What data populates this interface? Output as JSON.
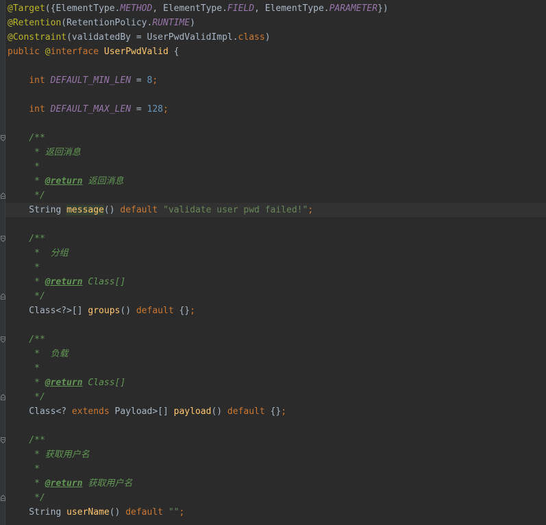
{
  "editor": {
    "theme_colors": {
      "background": "#2b2b2b",
      "annotation": "#bbb529",
      "keyword": "#cc7832",
      "constant": "#9876aa",
      "number": "#6897bb",
      "string": "#6a8759",
      "method": "#ffc66d",
      "doc_comment": "#629755",
      "text": "#a9b7c6"
    },
    "lines": [
      {
        "tokens": [
          {
            "c": "ann",
            "t": "@Target"
          },
          {
            "c": "plain",
            "t": "({ElementType."
          },
          {
            "c": "const",
            "t": "METHOD"
          },
          {
            "c": "plain",
            "t": ", ElementType."
          },
          {
            "c": "const",
            "t": "FIELD"
          },
          {
            "c": "plain",
            "t": ", ElementType."
          },
          {
            "c": "const",
            "t": "PARAMETER"
          },
          {
            "c": "plain",
            "t": "})"
          }
        ]
      },
      {
        "tokens": [
          {
            "c": "ann",
            "t": "@Retention"
          },
          {
            "c": "plain",
            "t": "(RetentionPolicy."
          },
          {
            "c": "const",
            "t": "RUNTIME"
          },
          {
            "c": "plain",
            "t": ")"
          }
        ]
      },
      {
        "tokens": [
          {
            "c": "ann",
            "t": "@Constraint"
          },
          {
            "c": "plain",
            "t": "(validatedBy = UserPwdValidImpl."
          },
          {
            "c": "kw",
            "t": "class"
          },
          {
            "c": "plain",
            "t": ")"
          }
        ]
      },
      {
        "tokens": [
          {
            "c": "kw",
            "t": "public "
          },
          {
            "c": "ann",
            "t": "@"
          },
          {
            "c": "kw",
            "t": "interface "
          },
          {
            "c": "fn",
            "t": "UserPwdValid"
          },
          {
            "c": "plain",
            "t": " {"
          }
        ]
      },
      {
        "tokens": []
      },
      {
        "tokens": [
          {
            "c": "plain",
            "t": "    "
          },
          {
            "c": "kw",
            "t": "int "
          },
          {
            "c": "const",
            "t": "DEFAULT_MIN_LEN"
          },
          {
            "c": "plain",
            "t": " = "
          },
          {
            "c": "num",
            "t": "8"
          },
          {
            "c": "kw",
            "t": ";"
          }
        ]
      },
      {
        "tokens": []
      },
      {
        "tokens": [
          {
            "c": "plain",
            "t": "    "
          },
          {
            "c": "kw",
            "t": "int "
          },
          {
            "c": "const",
            "t": "DEFAULT_MAX_LEN"
          },
          {
            "c": "plain",
            "t": " = "
          },
          {
            "c": "num",
            "t": "128"
          },
          {
            "c": "kw",
            "t": ";"
          }
        ]
      },
      {
        "tokens": []
      },
      {
        "tokens": [
          {
            "c": "doc",
            "t": "    /**"
          }
        ]
      },
      {
        "tokens": [
          {
            "c": "doc",
            "t": "     * 返回消息"
          }
        ]
      },
      {
        "tokens": [
          {
            "c": "doc",
            "t": "     *"
          }
        ]
      },
      {
        "tokens": [
          {
            "c": "doc",
            "t": "     * "
          },
          {
            "c": "tag",
            "t": "@return"
          },
          {
            "c": "doc",
            "t": " 返回消息"
          }
        ]
      },
      {
        "tokens": [
          {
            "c": "doc",
            "t": "     */"
          }
        ]
      },
      {
        "tokens": [
          {
            "c": "plain",
            "t": "    String "
          },
          {
            "c": "fn hl",
            "t": "message"
          },
          {
            "c": "plain",
            "t": "() "
          },
          {
            "c": "kw",
            "t": "default "
          },
          {
            "c": "str",
            "t": "\"validate user pwd failed!\""
          },
          {
            "c": "kw",
            "t": ";"
          }
        ]
      },
      {
        "tokens": []
      },
      {
        "tokens": [
          {
            "c": "doc",
            "t": "    /**"
          }
        ]
      },
      {
        "tokens": [
          {
            "c": "doc",
            "t": "     *  分组"
          }
        ]
      },
      {
        "tokens": [
          {
            "c": "doc",
            "t": "     *"
          }
        ]
      },
      {
        "tokens": [
          {
            "c": "doc",
            "t": "     * "
          },
          {
            "c": "tag",
            "t": "@return"
          },
          {
            "c": "doc",
            "t": " Class[]"
          }
        ]
      },
      {
        "tokens": [
          {
            "c": "doc",
            "t": "     */"
          }
        ]
      },
      {
        "tokens": [
          {
            "c": "plain",
            "t": "    Class<?>[] "
          },
          {
            "c": "fn",
            "t": "groups"
          },
          {
            "c": "plain",
            "t": "() "
          },
          {
            "c": "kw",
            "t": "default "
          },
          {
            "c": "plain",
            "t": "{}"
          },
          {
            "c": "kw",
            "t": ";"
          }
        ]
      },
      {
        "tokens": []
      },
      {
        "tokens": [
          {
            "c": "doc",
            "t": "    /**"
          }
        ]
      },
      {
        "tokens": [
          {
            "c": "doc",
            "t": "     *  负载"
          }
        ]
      },
      {
        "tokens": [
          {
            "c": "doc",
            "t": "     *"
          }
        ]
      },
      {
        "tokens": [
          {
            "c": "doc",
            "t": "     * "
          },
          {
            "c": "tag",
            "t": "@return"
          },
          {
            "c": "doc",
            "t": " Class[]"
          }
        ]
      },
      {
        "tokens": [
          {
            "c": "doc",
            "t": "     */"
          }
        ]
      },
      {
        "tokens": [
          {
            "c": "plain",
            "t": "    Class<? "
          },
          {
            "c": "kw",
            "t": "extends "
          },
          {
            "c": "plain",
            "t": "Payload>[] "
          },
          {
            "c": "fn",
            "t": "payload"
          },
          {
            "c": "plain",
            "t": "() "
          },
          {
            "c": "kw",
            "t": "default "
          },
          {
            "c": "plain",
            "t": "{}"
          },
          {
            "c": "kw",
            "t": ";"
          }
        ]
      },
      {
        "tokens": []
      },
      {
        "tokens": [
          {
            "c": "doc",
            "t": "    /**"
          }
        ]
      },
      {
        "tokens": [
          {
            "c": "doc",
            "t": "     * 获取用户名"
          }
        ]
      },
      {
        "tokens": [
          {
            "c": "doc",
            "t": "     *"
          }
        ]
      },
      {
        "tokens": [
          {
            "c": "doc",
            "t": "     * "
          },
          {
            "c": "tag",
            "t": "@return"
          },
          {
            "c": "doc",
            "t": " 获取用户名"
          }
        ]
      },
      {
        "tokens": [
          {
            "c": "doc",
            "t": "     */"
          }
        ]
      },
      {
        "tokens": [
          {
            "c": "plain",
            "t": "    String "
          },
          {
            "c": "fn",
            "t": "userName"
          },
          {
            "c": "plain",
            "t": "() "
          },
          {
            "c": "kw",
            "t": "default "
          },
          {
            "c": "str",
            "t": "\"\""
          },
          {
            "c": "kw",
            "t": ";"
          }
        ]
      }
    ],
    "caret_line": 14,
    "fold_markers": [
      {
        "line": 9,
        "icon": "fold-open-icon"
      },
      {
        "line": 13,
        "icon": "fold-close-icon"
      },
      {
        "line": 16,
        "icon": "fold-open-icon"
      },
      {
        "line": 20,
        "icon": "fold-close-icon"
      },
      {
        "line": 23,
        "icon": "fold-open-icon"
      },
      {
        "line": 27,
        "icon": "fold-close-icon"
      },
      {
        "line": 30,
        "icon": "fold-open-icon"
      },
      {
        "line": 34,
        "icon": "fold-close-icon"
      }
    ]
  }
}
